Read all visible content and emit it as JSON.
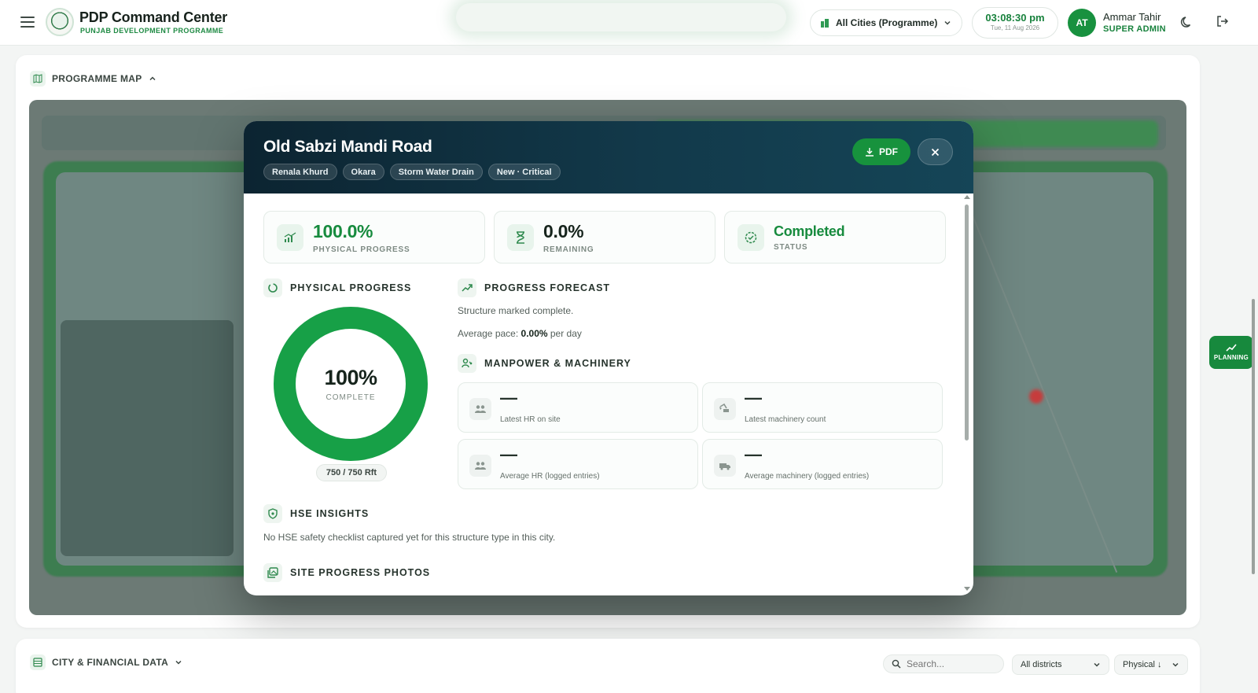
{
  "header": {
    "app_title": "PDP Command Center",
    "app_subtitle": "PUNJAB DEVELOPMENT PROGRAMME",
    "city_selector": "All Cities (Programme)",
    "time": "03:08:30 pm",
    "date": "Tue, 11 Aug 2026",
    "user_initials": "AT",
    "user_name": "Ammar Tahir",
    "user_role": "SUPER ADMIN"
  },
  "programme_map": {
    "title": "PROGRAMME MAP"
  },
  "modal": {
    "title": "Old Sabzi Mandi Road",
    "chips": [
      "Renala Khurd",
      "Okara",
      "Storm Water Drain",
      "New · Critical"
    ],
    "pdf_label": "PDF",
    "stats": [
      {
        "value": "100.0%",
        "label": "PHYSICAL PROGRESS"
      },
      {
        "value": "0.0%",
        "label": "REMAINING"
      },
      {
        "value": "Completed",
        "label": "STATUS"
      }
    ],
    "physical_progress": {
      "heading": "PHYSICAL PROGRESS",
      "percent": 100,
      "percent_label": "100%",
      "complete_label": "COMPLETE",
      "rft": "750 / 750 Rft"
    },
    "forecast": {
      "heading": "PROGRESS FORECAST",
      "note": "Structure marked complete.",
      "pace_prefix": "Average pace: ",
      "pace_value": "0.00%",
      "pace_suffix": " per day"
    },
    "manpower": {
      "heading": "MANPOWER & MACHINERY",
      "cards": [
        {
          "value": "—",
          "label": "Latest HR on site",
          "icon": "people-icon"
        },
        {
          "value": "—",
          "label": "Latest machinery count",
          "icon": "excavator-icon"
        },
        {
          "value": "—",
          "label": "Average HR (logged entries)",
          "icon": "people-icon"
        },
        {
          "value": "—",
          "label": "Average machinery (logged entries)",
          "icon": "truck-icon"
        }
      ]
    },
    "hse": {
      "heading": "HSE INSIGHTS",
      "text": "No HSE safety checklist captured yet for this structure type in this city."
    },
    "photos": {
      "heading": "SITE PROGRESS PHOTOS"
    }
  },
  "planning_button": "PLANNING",
  "city_financial": {
    "title": "CITY & FINANCIAL DATA",
    "search_placeholder": "Search...",
    "district_select": "All districts",
    "sort_select": "Physical ↓"
  },
  "colors": {
    "brand_green": "#17923d",
    "modal_header": "#12394a",
    "progress_ring": "#17a047"
  }
}
